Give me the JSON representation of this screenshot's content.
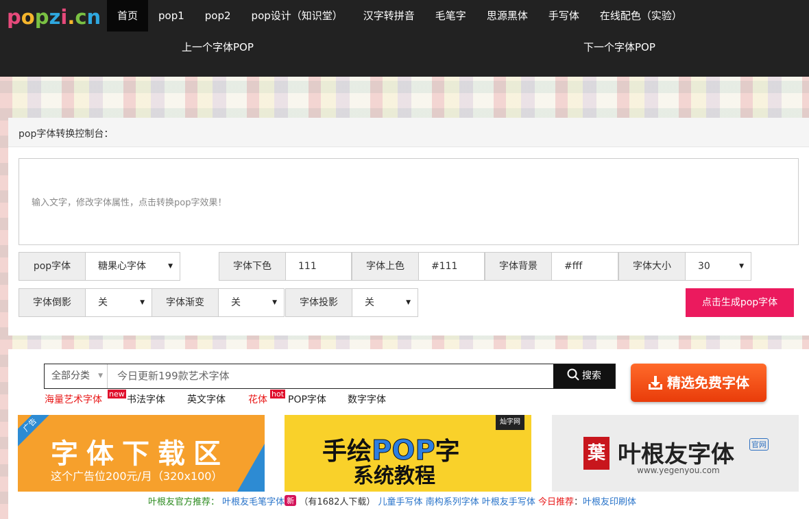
{
  "nav": {
    "logo": [
      "p",
      "o",
      "p",
      "z",
      "i",
      ".",
      "c",
      "n"
    ],
    "logo_colors": [
      "#e64a7b",
      "#f5b62d",
      "#7ac143",
      "#2fa8e0",
      "#e64a7b",
      "#f5b62d",
      "#7ac143",
      "#2fa8e0"
    ],
    "items": [
      "首页",
      "pop1",
      "pop2",
      "pop设计（知识堂）",
      "汉字转拼音",
      "毛笔字",
      "思源黑体",
      "手写体",
      "在线配色（实验）"
    ],
    "prev": "上一个字体POP",
    "next": "下一个字体POP"
  },
  "panel": {
    "title": "pop字体转换控制台：",
    "textarea_placeholder": "输入文字，修改字体属性，点击转换pop字效果！",
    "font_label": "pop字体",
    "font_value": "糖果心字体",
    "under_color_label": "字体下色",
    "under_color_value": "111",
    "upper_color_label": "字体上色",
    "upper_color_value": "#111",
    "bg_label": "字体背景",
    "bg_value": "#fff",
    "size_label": "字体大小",
    "size_value": "30",
    "reflection_label": "字体倒影",
    "reflection_value": "关",
    "gradient_label": "字体渐变",
    "gradient_value": "关",
    "shadow_label": "字体投影",
    "shadow_value": "关",
    "generate_button": "点击生成pop字体",
    "accent_color": "#eb1a5e"
  },
  "search": {
    "category": "全部分类",
    "placeholder": "今日更新199款艺术字体",
    "button": "搜索",
    "free_button": "精选免费字体"
  },
  "links": {
    "art": "海量艺术字体",
    "art_tag": "new",
    "calligraphy": "书法字体",
    "english": "英文字体",
    "fancy": "花体",
    "fancy_tag": "hot",
    "pop": "POP字体",
    "digital": "数字字体"
  },
  "banners": {
    "ad_corner": "广告",
    "ad_big": "字体下载区",
    "ad_small": "这个广告位200元/月（320x100）",
    "pop_line1_a": "手绘",
    "pop_line1_b": "POP",
    "pop_line1_c": "字",
    "pop_line2": "系统教程",
    "pop_stamp": "灿字网",
    "yegen_seal": "葉",
    "yegen_name": "叶根友字体",
    "yegen_official": "官网",
    "yegen_url": "www.yegenyou.com"
  },
  "recommend": {
    "label": "叶根友官方推荐：",
    "link1": "叶根友毛笔字体",
    "new_tag": "新",
    "downloads": "（有1682人下载）",
    "link2": "儿童手写体",
    "link3": "南构系列字体",
    "link4": "叶根友手写体",
    "today_label": "今日推荐",
    "colon": "：",
    "link5": "叶根友印刷体"
  }
}
